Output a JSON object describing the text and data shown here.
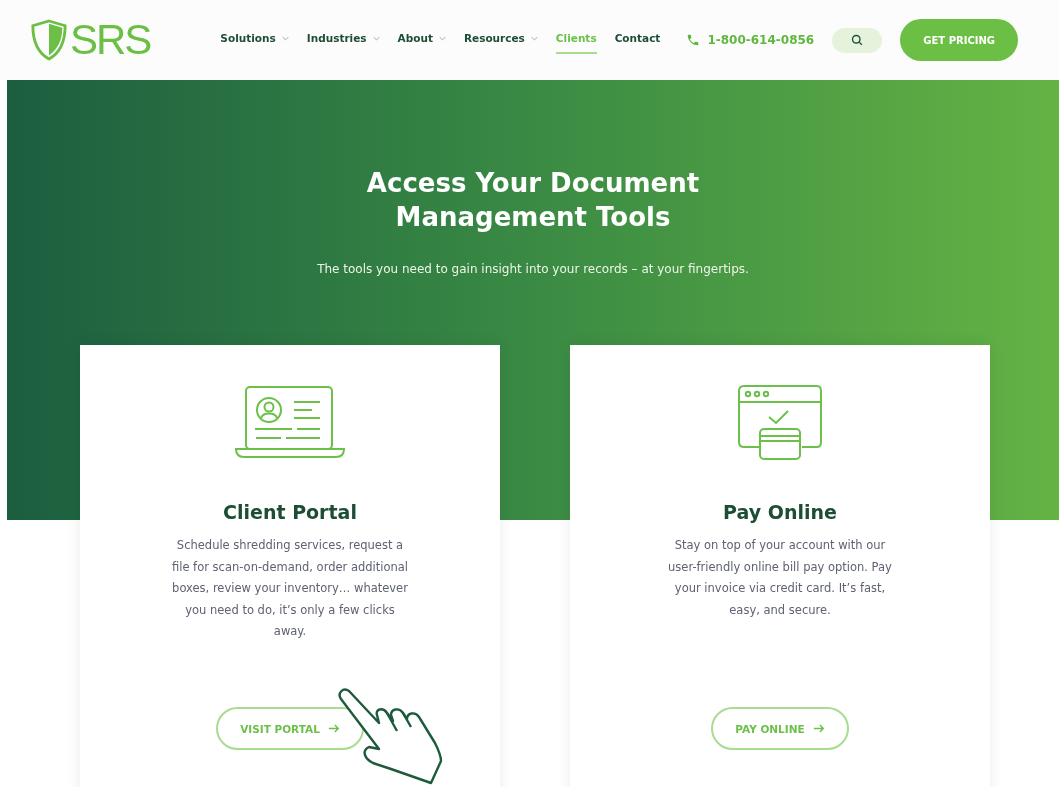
{
  "logo": {
    "text": "SRS"
  },
  "nav": [
    {
      "label": "Solutions",
      "dropdown": true,
      "selected": false
    },
    {
      "label": "Industries",
      "dropdown": true,
      "selected": false
    },
    {
      "label": "About",
      "dropdown": true,
      "selected": false
    },
    {
      "label": "Resources",
      "dropdown": true,
      "selected": false
    },
    {
      "label": "Clients",
      "dropdown": false,
      "selected": true
    },
    {
      "label": "Contact",
      "dropdown": false,
      "selected": false
    }
  ],
  "phone": "1-800-614-0856",
  "cta": "GET PRICING",
  "hero": {
    "title": "Access Your Document Management Tools",
    "subtitle": "The tools you need to gain insight into your records – at your fingertips."
  },
  "cards": [
    {
      "kind": "portal",
      "title": "Client Portal",
      "description": "Schedule shredding services, request a file for scan-on-demand, order additional boxes, review your inventory…  whatever you need to do, it’s only a few clicks away.",
      "button": "VISIT PORTAL"
    },
    {
      "kind": "payment",
      "title": "Pay Online",
      "description": "Stay on top of your account with our user-friendly online bill pay option.  Pay your invoice via credit card. It’s fast, easy, and secure.",
      "button": "PAY ONLINE"
    }
  ]
}
